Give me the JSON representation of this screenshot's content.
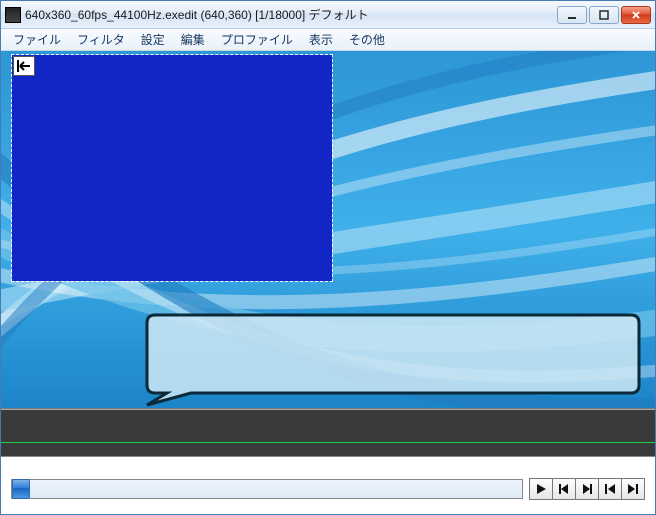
{
  "title": "640x360_60fps_44100Hz.exedit (640,360)  [1/18000]  デフォルト",
  "menu": {
    "file": "ファイル",
    "filter": "フィルタ",
    "settings": "設定",
    "edit": "編集",
    "profile": "プロファイル",
    "view": "表示",
    "other": "その他"
  },
  "colors": {
    "preview_fill": "#1226c5",
    "timeline_bg": "#3a3a3a",
    "timeline_marker": "#17d047"
  },
  "playback": {
    "position": 0,
    "total_frames": 18000
  }
}
